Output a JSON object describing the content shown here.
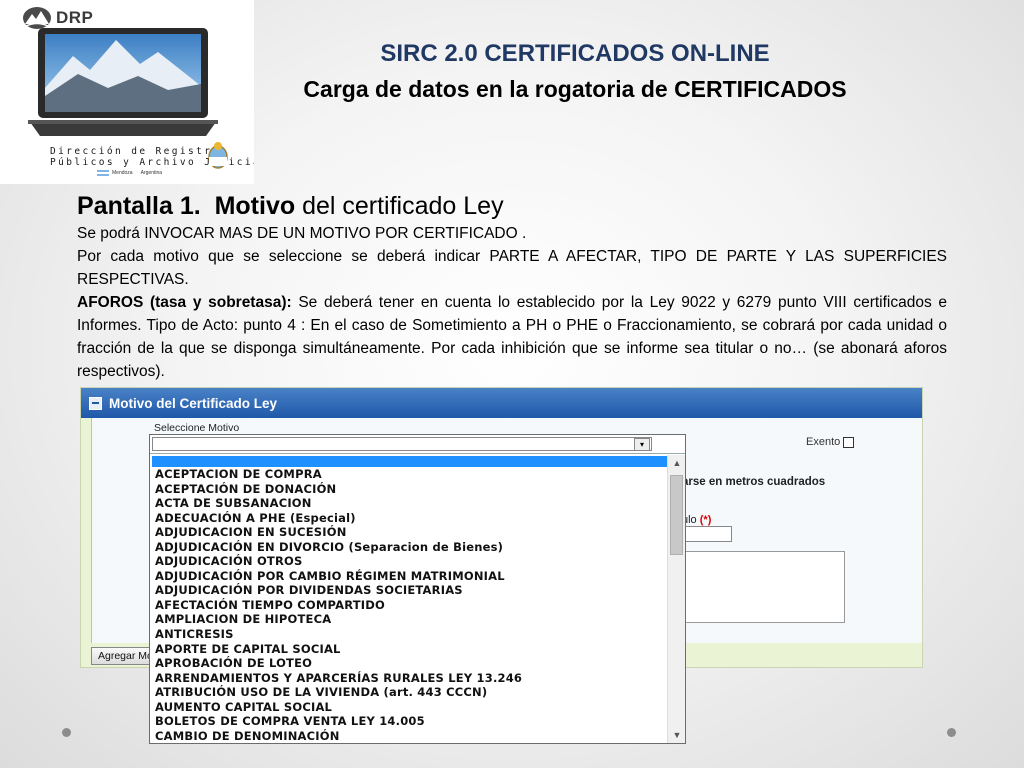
{
  "logo": {
    "brand": "DRP",
    "line1": "Dirección de Registros",
    "line2": "Públicos y Archivo Judicial",
    "line3_left": "Mendoza",
    "line3_right": "Argentina"
  },
  "header": {
    "title": "SIRC 2.0 CERTIFICADOS ON-LINE",
    "subtitle": "Carga de datos en la rogatoria de CERTIFICADOS"
  },
  "body": {
    "heading_pre": "Pantalla 1.",
    "heading_bold": "Motivo",
    "heading_post": " del certificado Ley",
    "line1": "Se podrá INVOCAR MAS DE UN MOTIVO POR CERTIFICADO .",
    "line2": "Por cada motivo que se seleccione se deberá indicar PARTE A AFECTAR, TIPO DE PARTE Y LAS SUPERFICIES RESPECTIVAS.",
    "aforos_bold": "AFOROS (tasa y sobretasa):",
    "aforos_text": " Se deberá tener en cuenta lo establecido por la Ley 9022 y 6279 punto VIII certificados e Informes. Tipo de Acto: punto 4 : En el caso de Sometimiento a PH o PHE o Fraccionamiento, se cobrará por cada unidad o fracción de la que se disponga simultáneamente. Por cada inhibición que se informe sea titular o no… (se abonará aforos respectivos)."
  },
  "panel": {
    "title": "Motivo del Certificado Ley",
    "select_label": "Seleccione Motivo",
    "exento_label": "Exento",
    "m2_text": "arse en metros cuadrados",
    "titulo_label": "ulo",
    "required_mark": "(*)",
    "add_button": "Agregar Mo"
  },
  "dropdown": {
    "options": [
      "ACEPTACION DE COMPRA",
      "ACEPTACIÓN DE DONACIÓN",
      "ACTA DE SUBSANACION",
      "ADECUACIÓN A PHE (Especial)",
      "ADJUDICACION EN SUCESIÓN",
      "ADJUDICACIÓN EN DIVORCIO (Separacion de Bienes)",
      "ADJUDICACIÓN OTROS",
      "ADJUDICACIÓN POR CAMBIO RÉGIMEN MATRIMONIAL",
      "ADJUDICACIÓN POR DIVIDENDAS SOCIETARIAS",
      "AFECTACIÓN TIEMPO COMPARTIDO",
      "AMPLIACION DE HIPOTECA",
      "ANTICRESIS",
      "APORTE DE CAPITAL SOCIAL",
      "APROBACIÓN DE LOTEO",
      "ARRENDAMIENTOS Y APARCERÍAS RURALES LEY 13.246",
      "ATRIBUCIÓN USO DE LA VIVIENDA (art. 443 CCCN)",
      "AUMENTO CAPITAL SOCIAL",
      "BOLETOS DE COMPRA VENTA LEY 14.005",
      "CAMBIO DE DENOMINACIÓN"
    ]
  },
  "colors": {
    "title_blue": "#1f3864",
    "panel_header": "#1e58a8",
    "highlight": "#1e90ff",
    "panel_bg": "#eaf3d3"
  }
}
